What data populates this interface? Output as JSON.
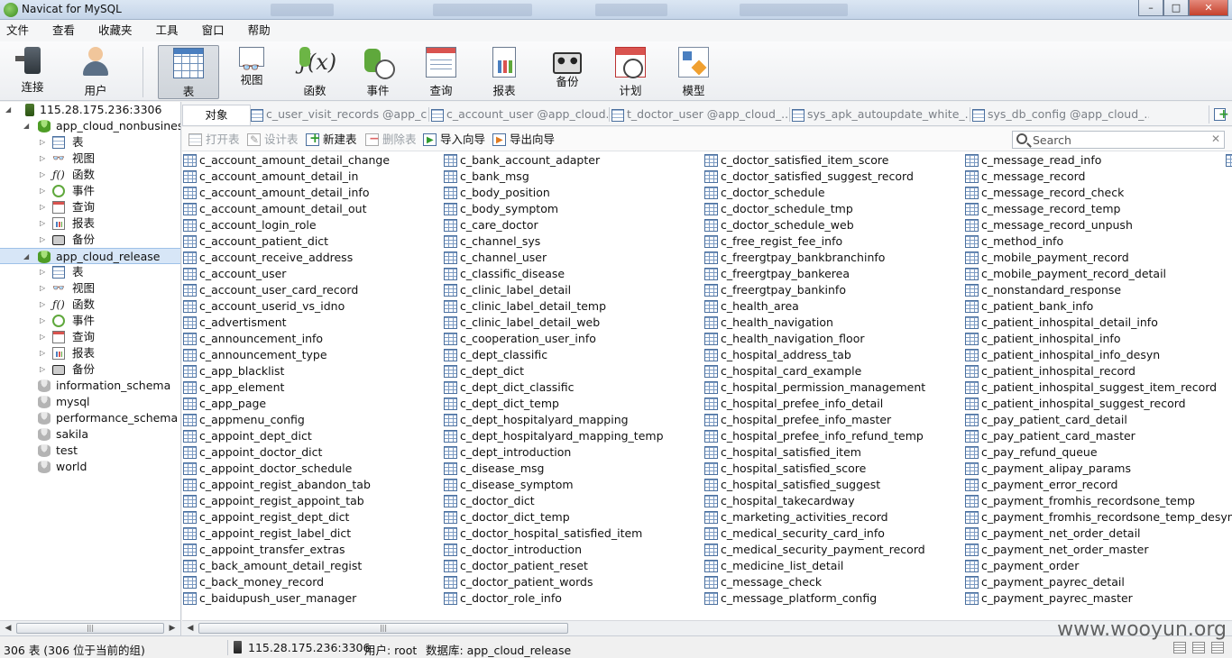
{
  "window": {
    "title": "Navicat for MySQL",
    "controls": {
      "minimize": "–",
      "maximize": "□",
      "close": "✕"
    }
  },
  "menu": [
    "文件",
    "查看",
    "收藏夹",
    "工具",
    "窗口",
    "帮助"
  ],
  "toolbar": [
    {
      "label": "连接",
      "icon": "plug-icon"
    },
    {
      "label": "用户",
      "icon": "user-icon"
    },
    {
      "label": "表",
      "icon": "table-icon",
      "active": true
    },
    {
      "label": "视图",
      "icon": "view-icon"
    },
    {
      "label": "函数",
      "icon": "function-icon"
    },
    {
      "label": "事件",
      "icon": "event-icon"
    },
    {
      "label": "查询",
      "icon": "query-icon"
    },
    {
      "label": "报表",
      "icon": "report-icon"
    },
    {
      "label": "备份",
      "icon": "backup-icon"
    },
    {
      "label": "计划",
      "icon": "schedule-icon"
    },
    {
      "label": "模型",
      "icon": "model-icon"
    }
  ],
  "tree": {
    "connection": "115.28.175.236:3306",
    "databases": [
      {
        "name": "app_cloud_nonbusiness",
        "open": true,
        "children": [
          "表",
          "视图",
          "函数",
          "事件",
          "查询",
          "报表",
          "备份"
        ]
      },
      {
        "name": "app_cloud_release",
        "open": true,
        "selected": true,
        "children": [
          "表",
          "视图",
          "函数",
          "事件",
          "查询",
          "报表",
          "备份"
        ]
      },
      {
        "name": "information_schema",
        "open": false
      },
      {
        "name": "mysql",
        "open": false
      },
      {
        "name": "performance_schema",
        "open": false
      },
      {
        "name": "sakila",
        "open": false
      },
      {
        "name": "test",
        "open": false
      },
      {
        "name": "world",
        "open": false
      }
    ]
  },
  "tabs": {
    "objects_label": "对象",
    "open_tabs": [
      "c_user_visit_records @app_c...",
      "c_account_user @app_cloud...",
      "t_doctor_user @app_cloud_...",
      "sys_apk_autoupdate_white_...",
      "sys_db_config @app_cloud_..."
    ]
  },
  "object_toolbar": {
    "open_table": "打开表",
    "design_table": "设计表",
    "new_table": "新建表",
    "delete_table": "删除表",
    "import_wizard": "导入向导",
    "export_wizard": "导出向导",
    "search_placeholder": "Search",
    "search_clear": "✕"
  },
  "objects": {
    "columns": [
      [
        "c_account_amount_detail_change",
        "c_account_amount_detail_in",
        "c_account_amount_detail_info",
        "c_account_amount_detail_out",
        "c_account_login_role",
        "c_account_patient_dict",
        "c_account_receive_address",
        "c_account_user",
        "c_account_user_card_record",
        "c_account_userid_vs_idno",
        "c_advertisment",
        "c_announcement_info",
        "c_announcement_type",
        "c_app_blacklist",
        "c_app_element",
        "c_app_page",
        "c_appmenu_config",
        "c_appoint_dept_dict",
        "c_appoint_doctor_dict",
        "c_appoint_doctor_schedule",
        "c_appoint_regist_abandon_tab",
        "c_appoint_regist_appoint_tab",
        "c_appoint_regist_dept_dict",
        "c_appoint_regist_label_dict",
        "c_appoint_transfer_extras",
        "c_back_amount_detail_regist",
        "c_back_money_record",
        "c_baidupush_user_manager"
      ],
      [
        "c_bank_account_adapter",
        "c_bank_msg",
        "c_body_position",
        "c_body_symptom",
        "c_care_doctor",
        "c_channel_sys",
        "c_channel_user",
        "c_classific_disease",
        "c_clinic_label_detail",
        "c_clinic_label_detail_temp",
        "c_clinic_label_detail_web",
        "c_cooperation_user_info",
        "c_dept_classific",
        "c_dept_dict",
        "c_dept_dict_classific",
        "c_dept_dict_temp",
        "c_dept_hospitalyard_mapping",
        "c_dept_hospitalyard_mapping_temp",
        "c_dept_introduction",
        "c_disease_msg",
        "c_disease_symptom",
        "c_doctor_dict",
        "c_doctor_dict_temp",
        "c_doctor_hospital_satisfied_item",
        "c_doctor_introduction",
        "c_doctor_patient_reset",
        "c_doctor_patient_words",
        "c_doctor_role_info"
      ],
      [
        "c_doctor_satisfied_item_score",
        "c_doctor_satisfied_suggest_record",
        "c_doctor_schedule",
        "c_doctor_schedule_tmp",
        "c_doctor_schedule_web",
        "c_free_regist_fee_info",
        "c_freergtpay_bankbranchinfo",
        "c_freergtpay_bankerea",
        "c_freergtpay_bankinfo",
        "c_health_area",
        "c_health_navigation",
        "c_health_navigation_floor",
        "c_hospital_address_tab",
        "c_hospital_card_example",
        "c_hospital_permission_management",
        "c_hospital_prefee_info_detail",
        "c_hospital_prefee_info_master",
        "c_hospital_prefee_info_refund_temp",
        "c_hospital_satisfied_item",
        "c_hospital_satisfied_score",
        "c_hospital_satisfied_suggest",
        "c_hospital_takecardway",
        "c_marketing_activities_record",
        "c_medical_security_card_info",
        "c_medical_security_payment_record",
        "c_medicine_list_detail",
        "c_message_check",
        "c_message_platform_config"
      ],
      [
        "c_message_read_info",
        "c_message_record",
        "c_message_record_check",
        "c_message_record_temp",
        "c_message_record_unpush",
        "c_method_info",
        "c_mobile_payment_record",
        "c_mobile_payment_record_detail",
        "c_nonstandard_response",
        "c_patient_bank_info",
        "c_patient_inhospital_detail_info",
        "c_patient_inhospital_info",
        "c_patient_inhospital_info_desyn",
        "c_patient_inhospital_record",
        "c_patient_inhospital_suggest_item_record",
        "c_patient_inhospital_suggest_record",
        "c_pay_patient_card_detail",
        "c_pay_patient_card_master",
        "c_pay_refund_queue",
        "c_payment_alipay_params",
        "c_payment_error_record",
        "c_payment_fromhis_recordsone_temp",
        "c_payment_fromhis_recordsone_temp_desyn",
        "c_payment_net_order_detail",
        "c_payment_net_order_master",
        "c_payment_order",
        "c_payment_payrec_detail",
        "c_payment_payrec_master"
      ]
    ]
  },
  "scrollbars": {
    "thumb_grip": "|||",
    "left": "◀",
    "right": "▶"
  },
  "status": {
    "count": "306 表 (306 位于当前的组)",
    "server": "115.28.175.236:3306",
    "user": "用户: root",
    "database": "数据库: app_cloud_release",
    "watermark": "www.wooyun.org"
  }
}
